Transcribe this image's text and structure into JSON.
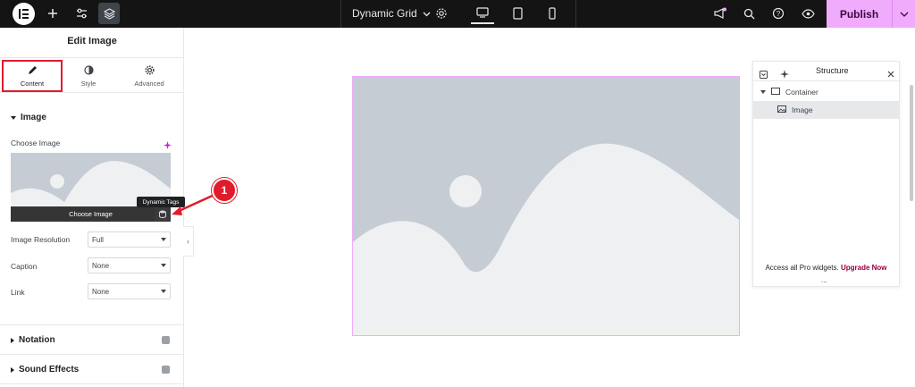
{
  "topbar": {
    "document_title": "Dynamic Grid",
    "publish_label": "Publish",
    "icons": [
      "elementor-logo-icon",
      "add-icon",
      "settings-sliders-icon",
      "layers-icon",
      "gear-icon",
      "desktop-icon",
      "tablet-icon",
      "mobile-icon",
      "announcement-icon",
      "search-icon",
      "help-icon",
      "preview-eye-icon",
      "chevron-down-icon"
    ],
    "accent": "#f0abfc"
  },
  "panel": {
    "title": "Edit Image",
    "tabs": [
      {
        "label": "Content",
        "active": true
      },
      {
        "label": "Style",
        "active": false
      },
      {
        "label": "Advanced",
        "active": false
      }
    ],
    "section_image": "Image",
    "choose_image_label": "Choose Image",
    "choose_image_button": "Choose Image",
    "dynamic_tags_tooltip": "Dynamic Tags",
    "fields": [
      {
        "label": "Image Resolution",
        "value": "Full"
      },
      {
        "label": "Caption",
        "value": "None"
      },
      {
        "label": "Link",
        "value": "None"
      }
    ],
    "sections_collapsed": [
      "Notation",
      "Sound Effects"
    ]
  },
  "annotation": {
    "marker": "1",
    "color": "#e01b2b"
  },
  "structure": {
    "title": "Structure",
    "items": [
      {
        "label": "Container",
        "selected": false
      },
      {
        "label": "Image",
        "selected": true
      }
    ],
    "footer_text": "Access all Pro widgets.",
    "footer_link": "Upgrade Now",
    "more": "..."
  }
}
